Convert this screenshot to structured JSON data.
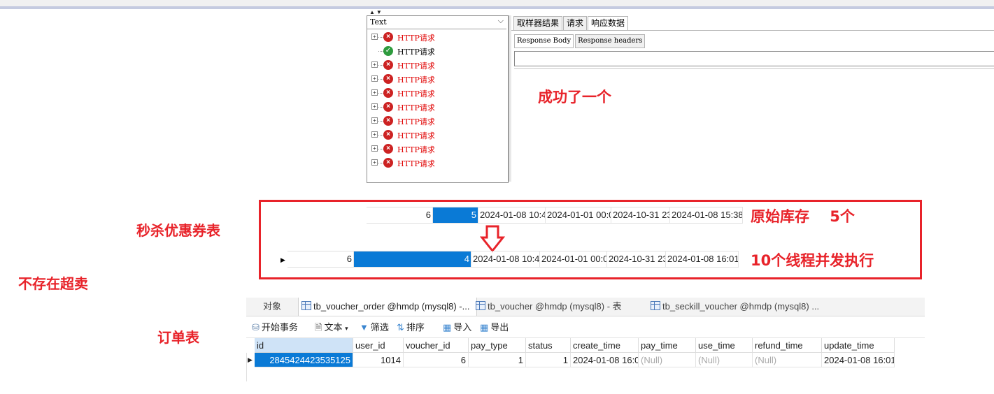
{
  "jmeter": {
    "view_selector": "Text",
    "samples": [
      {
        "label": "HTTP请求",
        "status": "fail"
      },
      {
        "label": "HTTP请求",
        "status": "ok"
      },
      {
        "label": "HTTP请求",
        "status": "fail"
      },
      {
        "label": "HTTP请求",
        "status": "fail"
      },
      {
        "label": "HTTP请求",
        "status": "fail"
      },
      {
        "label": "HTTP请求",
        "status": "fail"
      },
      {
        "label": "HTTP请求",
        "status": "fail"
      },
      {
        "label": "HTTP请求",
        "status": "fail"
      },
      {
        "label": "HTTP请求",
        "status": "fail"
      },
      {
        "label": "HTTP请求",
        "status": "fail"
      }
    ],
    "tabs": [
      "取样器结果",
      "请求",
      "响应数据"
    ],
    "active_tab": "响应数据",
    "sub_tabs": [
      "Response Body",
      "Response headers"
    ]
  },
  "annotations": {
    "success_one": "成功了一个",
    "seckill_table": "秒杀优惠券表",
    "no_oversell": "不存在超卖",
    "order_table": "订单表",
    "original_stock": "原始库存    5个",
    "concurrent": "10个线程并发执行"
  },
  "seckill_before": {
    "voucher_id": "6",
    "stock": "5",
    "create_time": "2024-01-08 10:4",
    "begin_time": "2024-01-01 00:0",
    "end_time": "2024-10-31 23",
    "update_time": "2024-01-08 15:38"
  },
  "seckill_after": {
    "voucher_id": "6",
    "stock": "4",
    "create_time": "2024-01-08 10:4",
    "begin_time": "2024-01-01 00:0",
    "end_time": "2024-10-31 23",
    "update_time": "2024-01-08 16:01"
  },
  "navicat": {
    "object_tab": "对象",
    "tabs": [
      "tb_voucher_order @hmdp (mysql8) -...",
      "tb_voucher @hmdp (mysql8) - 表",
      "tb_seckill_voucher @hmdp (mysql8) ..."
    ],
    "toolbar": {
      "begin_tx": "开始事务",
      "text": "文本",
      "filter": "筛选",
      "sort": "排序",
      "import": "导入",
      "export": "导出"
    },
    "columns": [
      "id",
      "user_id",
      "voucher_id",
      "pay_type",
      "status",
      "create_time",
      "pay_time",
      "use_time",
      "refund_time",
      "update_time"
    ],
    "row": {
      "id": "2845424423535125",
      "user_id": "1014",
      "voucher_id": "6",
      "pay_type": "1",
      "status": "1",
      "create_time": "2024-01-08 16:0",
      "pay_time": "(Null)",
      "use_time": "(Null)",
      "refund_time": "(Null)",
      "update_time": "2024-01-08 16:01"
    }
  }
}
